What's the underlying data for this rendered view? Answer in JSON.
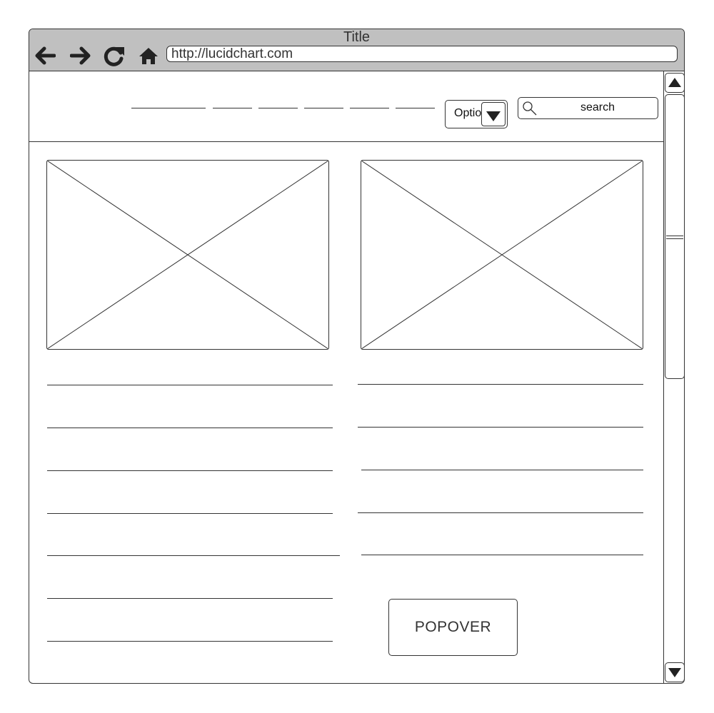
{
  "window": {
    "title": "Title"
  },
  "browser": {
    "url": "http://lucidchart.com",
    "nav_icons": [
      "back-arrow-icon",
      "forward-arrow-icon",
      "refresh-icon",
      "home-icon"
    ]
  },
  "header": {
    "option_select": {
      "selected": "Option"
    },
    "search": {
      "placeholder": "search"
    }
  },
  "content": {
    "popover_label": "POPOVER"
  },
  "colors": {
    "titlebar": "#c0c0c0",
    "stroke": "#333333",
    "background": "#ffffff"
  }
}
